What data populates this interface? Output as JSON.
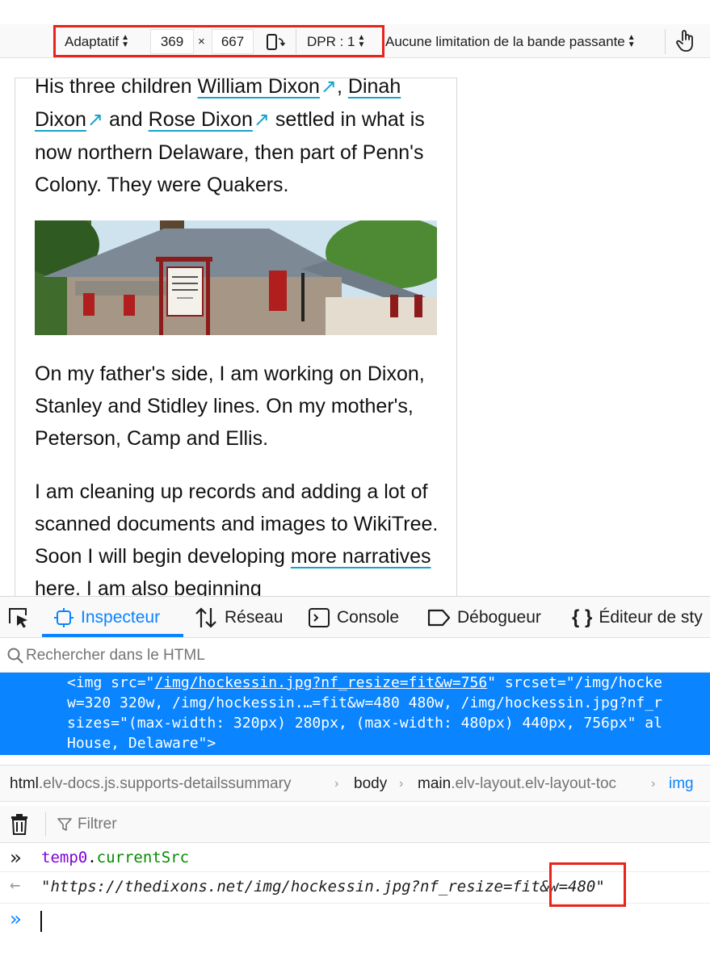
{
  "rdm_toolbar": {
    "device_label": "Adaptatif",
    "width_value": "369",
    "times_sign": "×",
    "height_value": "667",
    "dpr_label": "DPR : 1",
    "throttle_label": "Aucune limitation de la bande passante",
    "rotate_icon": "rotate-device-icon",
    "touch_icon": "touch-simulation-icon",
    "highlight_color": "#e8231a"
  },
  "page": {
    "para1": {
      "text_before": "His three children ",
      "link1": "William Dixon",
      "sep1": ", ",
      "link2": "Dinah Dixon",
      "sep2": " and ",
      "link3": "Rose Dixon",
      "text_after": " settled in what is now northern Delaware, then part of Penn's Colony. They were Quakers.",
      "ext_glyph": "↗"
    },
    "sign_text": "HOCKESSIN FRIENDS MEETING 1730",
    "para2": "On my father's side, I am working on Dixon, Stanley and Stidley lines. On my mother's, Peterson, Camp and Ellis.",
    "para3": {
      "text_before": "I am cleaning up records and adding a lot of scanned documents and images to WikiTree. Soon I will begin developing ",
      "link": "more narratives",
      "text_after": " here. I am also beginning"
    },
    "link_color": "#16a3c9"
  },
  "devtools_tabs": [
    {
      "label": "Inspecteur",
      "icon": "inspector-icon",
      "active": true
    },
    {
      "label": "Réseau",
      "icon": "network-icon",
      "active": false
    },
    {
      "label": "Console",
      "icon": "console-icon",
      "active": false
    },
    {
      "label": "Débogueur",
      "icon": "debugger-icon",
      "active": false
    },
    {
      "label": "Éditeur de sty",
      "icon": "style-editor-icon",
      "active": false
    }
  ],
  "search": {
    "placeholder": "Rechercher dans le HTML"
  },
  "markup": {
    "line1_a": "<img src=\"",
    "line1_link": "/img/hockessin.jpg?nf_resize=fit&w=756",
    "line1_b": "\" srcset=\"/img/hocke",
    "line2": "w=320 320w, /img/hockessin.…=fit&w=480 480w, /img/hockessin.jpg?nf_r",
    "line3": "sizes=\"(max-width: 320px) 280px, (max-width: 480px) 440px, 756px\" al",
    "line4": "House, Delaware\">",
    "selected_color": "#0a84ff"
  },
  "breadcrumbs": [
    {
      "tag": "html",
      "cls": ".elv-docs.js.supports-detailssummary"
    },
    {
      "tag": "body",
      "cls": ""
    },
    {
      "tag": "main",
      "cls": ".elv-layout.elv-layout-toc"
    },
    {
      "tag": "img",
      "cls": ""
    }
  ],
  "console": {
    "filter_placeholder": "Filtrer",
    "input_obj": "temp0",
    "input_dot": ".",
    "input_prop": "currentSrc",
    "result_quote_open": "\"",
    "result_url_main": "https://thedixons.net/img/hockessin.jpg?nf_resize=fit",
    "result_url_param": "&w=480",
    "result_quote_close": "\"",
    "prompt_glyph": "»",
    "return_glyph": "←"
  }
}
